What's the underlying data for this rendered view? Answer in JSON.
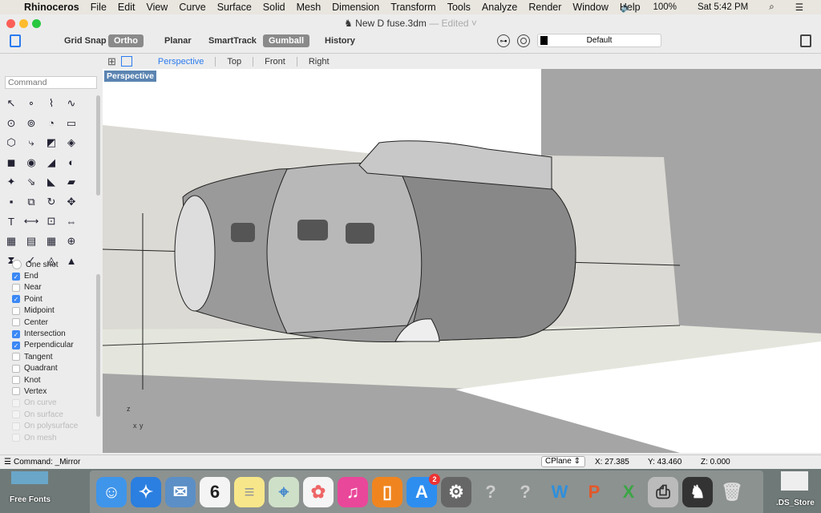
{
  "menubar": {
    "app": "Rhinoceros",
    "items": [
      "File",
      "Edit",
      "View",
      "Curve",
      "Surface",
      "Solid",
      "Mesh",
      "Dimension",
      "Transform",
      "Tools",
      "Analyze",
      "Render",
      "Window",
      "Help"
    ],
    "battery": "100%",
    "clock": "Sat 5:42 PM"
  },
  "window": {
    "title": "New D fuse.3dm",
    "edited": "— Edited"
  },
  "toolbar": {
    "buttons": [
      {
        "label": "Grid Snap",
        "on": false
      },
      {
        "label": "Ortho",
        "on": true
      },
      {
        "label": "Planar",
        "on": false
      },
      {
        "label": "SmartTrack",
        "on": false
      },
      {
        "label": "Gumball",
        "on": true
      },
      {
        "label": "History",
        "on": false
      }
    ],
    "layer": "Default"
  },
  "viewtabs": [
    "Perspective",
    "Top",
    "Front",
    "Right"
  ],
  "active_view": "Perspective",
  "command": {
    "placeholder": "Command"
  },
  "tool_icons": [
    "select-icon",
    "point-icon",
    "polyline-icon",
    "curve-icon",
    "circle-icon",
    "ellipse-icon",
    "arc-icon",
    "rectangle-icon",
    "polygon-icon",
    "fillet-icon",
    "surface-icon",
    "patch-icon",
    "box-icon",
    "sphere-icon",
    "extrude-icon",
    "revolve-icon",
    "explode-icon",
    "trim-icon",
    "split-icon",
    "join-icon",
    "group-icon",
    "array-icon",
    "rotate-icon",
    "move-icon",
    "text-icon",
    "dimension-icon",
    "scale-icon",
    "mirror-icon",
    "mesh-icon",
    "layout-icon",
    "grid-icon",
    "gumball-icon",
    "drape-icon",
    "check-icon",
    "analyze-icon",
    "render-icon"
  ],
  "osnap": [
    {
      "label": "One shot",
      "type": "radio",
      "checked": false
    },
    {
      "label": "End",
      "checked": true
    },
    {
      "label": "Near",
      "checked": false
    },
    {
      "label": "Point",
      "checked": true
    },
    {
      "label": "Midpoint",
      "checked": false
    },
    {
      "label": "Center",
      "checked": false
    },
    {
      "label": "Intersection",
      "checked": true
    },
    {
      "label": "Perpendicular",
      "checked": true
    },
    {
      "label": "Tangent",
      "checked": false
    },
    {
      "label": "Quadrant",
      "checked": false
    },
    {
      "label": "Knot",
      "checked": false
    },
    {
      "label": "Vertex",
      "checked": false
    },
    {
      "label": "On curve",
      "checked": false,
      "disabled": true
    },
    {
      "label": "On surface",
      "checked": false,
      "disabled": true
    },
    {
      "label": "On polysurface",
      "checked": false,
      "disabled": true
    },
    {
      "label": "On mesh",
      "checked": false,
      "disabled": true
    }
  ],
  "status": {
    "command": "Command: _Mirror",
    "cplane": "CPlane",
    "x": "X: 27.385",
    "y": "Y: 43.460",
    "z": "Z: 0.000"
  },
  "axes": {
    "z": "z",
    "x": "x",
    "y": "y"
  },
  "dock": [
    {
      "name": "finder",
      "color": "#3f95ea",
      "glyph": "☺"
    },
    {
      "name": "safari",
      "color": "#2b7fe0",
      "glyph": "✧"
    },
    {
      "name": "mail",
      "color": "#5b8fc6",
      "glyph": "✉"
    },
    {
      "name": "calendar",
      "color": "#f4f4f4",
      "glyph": "6",
      "text": "#222"
    },
    {
      "name": "notes",
      "color": "#f7e78a",
      "glyph": "≡",
      "text": "#999"
    },
    {
      "name": "maps",
      "color": "#cfe0c8",
      "glyph": "⌖",
      "text": "#48c"
    },
    {
      "name": "photos",
      "color": "#f5f5f5",
      "glyph": "✿",
      "text": "#e66"
    },
    {
      "name": "itunes",
      "color": "#e9479a",
      "glyph": "♫"
    },
    {
      "name": "ibooks",
      "color": "#f0851f",
      "glyph": "▯"
    },
    {
      "name": "app-store",
      "color": "#2d8ef0",
      "glyph": "A",
      "badge": "2"
    },
    {
      "name": "system-preferences",
      "color": "#666",
      "glyph": "⚙"
    },
    {
      "name": "unknown-app",
      "color": "transparent",
      "glyph": "?",
      "text": "#ccc"
    },
    {
      "name": "unknown-app",
      "color": "transparent",
      "glyph": "?",
      "text": "#ccc"
    },
    {
      "name": "word",
      "color": "transparent",
      "glyph": "W",
      "text": "#2f8fdc"
    },
    {
      "name": "powerpoint",
      "color": "transparent",
      "glyph": "P",
      "text": "#e4572a"
    },
    {
      "name": "excel",
      "color": "transparent",
      "glyph": "X",
      "text": "#3aa645"
    },
    {
      "name": "printer",
      "color": "#bbb",
      "glyph": "⎙",
      "text": "#333"
    },
    {
      "name": "rhinoceros",
      "color": "#333",
      "glyph": "♞"
    },
    {
      "name": "trash",
      "color": "transparent",
      "glyph": "🗑",
      "text": "#ddd"
    }
  ],
  "desktop": {
    "left": "Free Fonts",
    "right": ".DS_Store"
  }
}
